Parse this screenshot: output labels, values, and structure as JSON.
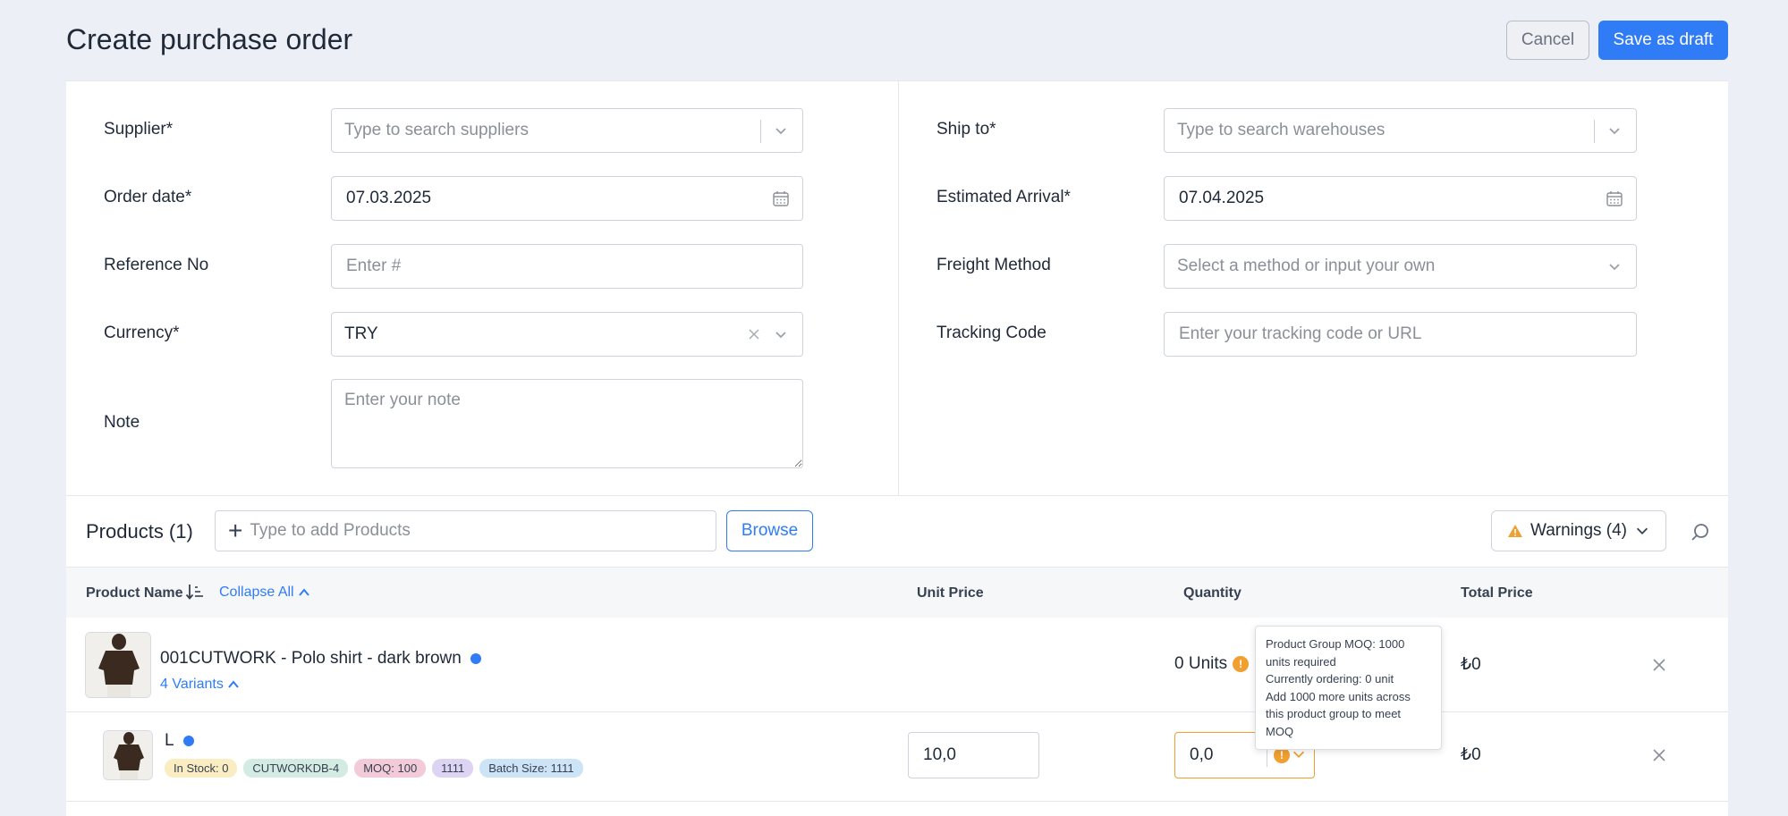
{
  "header": {
    "title": "Create purchase order",
    "cancel_label": "Cancel",
    "save_label": "Save as draft"
  },
  "form": {
    "supplier": {
      "label": "Supplier*",
      "placeholder": "Type to search suppliers"
    },
    "order_date": {
      "label": "Order date*",
      "value": "07.03.2025"
    },
    "reference": {
      "label": "Reference No",
      "placeholder": "Enter #"
    },
    "currency": {
      "label": "Currency*",
      "value": "TRY"
    },
    "note": {
      "label": "Note",
      "placeholder": "Enter your note"
    },
    "ship_to": {
      "label": "Ship to*",
      "placeholder": "Type to search warehouses"
    },
    "estimated_arrival": {
      "label": "Estimated Arrival*",
      "value": "07.04.2025"
    },
    "freight_method": {
      "label": "Freight Method",
      "placeholder": "Select a method or input your own"
    },
    "tracking_code": {
      "label": "Tracking Code",
      "placeholder": "Enter your tracking code or URL"
    }
  },
  "products": {
    "title": "Products (1)",
    "add_placeholder": "Type to add Products",
    "browse_label": "Browse",
    "warnings_label": "Warnings (4)",
    "columns": {
      "product_name": "Product Name",
      "collapse_all": "Collapse All",
      "unit_price": "Unit Price",
      "quantity": "Quantity",
      "total_price": "Total Price"
    },
    "group": {
      "name": "001CUTWORK - Polo shirt - dark brown",
      "variants_label": "4 Variants",
      "units": "0 Units",
      "total": "₺0"
    },
    "variant": {
      "name": "L",
      "tags": [
        {
          "text": "In Stock: 0",
          "color": "#fbedc2"
        },
        {
          "text": "CUTWORKDB-4",
          "color": "#d3ebe3"
        },
        {
          "text": "MOQ: 100",
          "color": "#f3cbd8"
        },
        {
          "text": "1111",
          "color": "#ddd3f3"
        },
        {
          "text": "Batch Size: 1111",
          "color": "#cde4f6"
        }
      ],
      "unit_price": "10,0",
      "quantity": "0,0",
      "total": "₺0"
    },
    "tooltip": {
      "line1": "Product Group MOQ: 1000 units required",
      "line2": "Currently ordering: 0 unit",
      "line3": "Add 1000 more units across this product group to meet MOQ"
    }
  },
  "colors": {
    "accent": "#2f7cf6",
    "warning": "#f0a030",
    "background": "#eceff5"
  }
}
